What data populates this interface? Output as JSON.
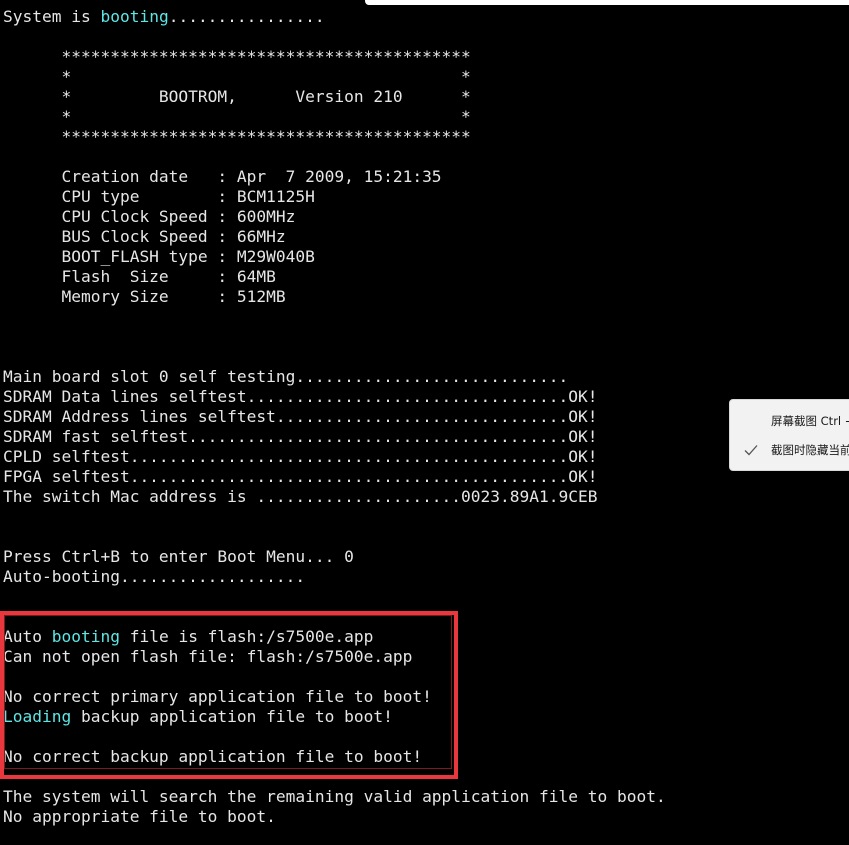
{
  "terminal": {
    "lines": [
      [
        {
          "t": "System is "
        },
        {
          "t": "booting",
          "hl": true
        },
        {
          "t": "................"
        }
      ],
      [
        {
          "t": ""
        }
      ],
      [
        {
          "t": "      ******************************************"
        }
      ],
      [
        {
          "t": "      *                                        *"
        }
      ],
      [
        {
          "t": "      *         BOOTROM,      Version 210      *"
        }
      ],
      [
        {
          "t": "      *                                        *"
        }
      ],
      [
        {
          "t": "      ******************************************"
        }
      ],
      [
        {
          "t": ""
        }
      ],
      [
        {
          "t": "      Creation date   : Apr  7 2009, 15:21:35"
        }
      ],
      [
        {
          "t": "      CPU type        : BCM1125H"
        }
      ],
      [
        {
          "t": "      CPU Clock Speed : 600MHz"
        }
      ],
      [
        {
          "t": "      BUS Clock Speed : 66MHz"
        }
      ],
      [
        {
          "t": "      BOOT_FLASH type : M29W040B"
        }
      ],
      [
        {
          "t": "      Flash  Size     : 64MB"
        }
      ],
      [
        {
          "t": "      Memory Size     : 512MB"
        }
      ],
      [
        {
          "t": ""
        }
      ],
      [
        {
          "t": ""
        }
      ],
      [
        {
          "t": ""
        }
      ],
      [
        {
          "t": "Main board slot 0 self testing............................"
        }
      ],
      [
        {
          "t": "SDRAM Data lines selftest.................................OK!"
        }
      ],
      [
        {
          "t": "SDRAM Address lines selftest..............................OK!"
        }
      ],
      [
        {
          "t": "SDRAM fast selftest.......................................OK!"
        }
      ],
      [
        {
          "t": "CPLD selftest.............................................OK!"
        }
      ],
      [
        {
          "t": "FPGA selftest.............................................OK!"
        }
      ],
      [
        {
          "t": "The switch Mac address is .....................0023.89A1.9CEB"
        }
      ],
      [
        {
          "t": ""
        }
      ],
      [
        {
          "t": ""
        }
      ],
      [
        {
          "t": "Press Ctrl+B to enter Boot Menu... 0"
        }
      ],
      [
        {
          "t": "Auto-booting..................."
        }
      ],
      [
        {
          "t": ""
        }
      ],
      [
        {
          "t": ""
        }
      ],
      [
        {
          "t": "Auto "
        },
        {
          "t": "booting",
          "hl": true
        },
        {
          "t": " file is flash:/s7500e.app"
        }
      ],
      [
        {
          "t": "Can not open flash file: flash:/s7500e.app"
        }
      ],
      [
        {
          "t": ""
        }
      ],
      [
        {
          "t": "No correct primary application file to boot!"
        }
      ],
      [
        {
          "t": "Loading",
          "hl": true
        },
        {
          "t": " backup application file to boot!"
        }
      ],
      [
        {
          "t": ""
        }
      ],
      [
        {
          "t": "No correct backup application file to boot!"
        }
      ],
      [
        {
          "t": ""
        }
      ],
      [
        {
          "t": "The system will search the remaining valid application file to boot."
        }
      ],
      [
        {
          "t": "No appropriate file to boot."
        }
      ]
    ]
  },
  "context_menu": {
    "screenshot_label": "屏幕截图 Ctrl + Alt + A",
    "hide_window_label": "截图时隐藏当前窗口",
    "hide_window_checked": true
  },
  "colors": {
    "background": "#000000",
    "text": "#e6e6e6",
    "highlight_text": "#5ee6e6",
    "annotation_box": "#e8383d"
  },
  "icons": {
    "hide_window_check": "check-icon"
  }
}
